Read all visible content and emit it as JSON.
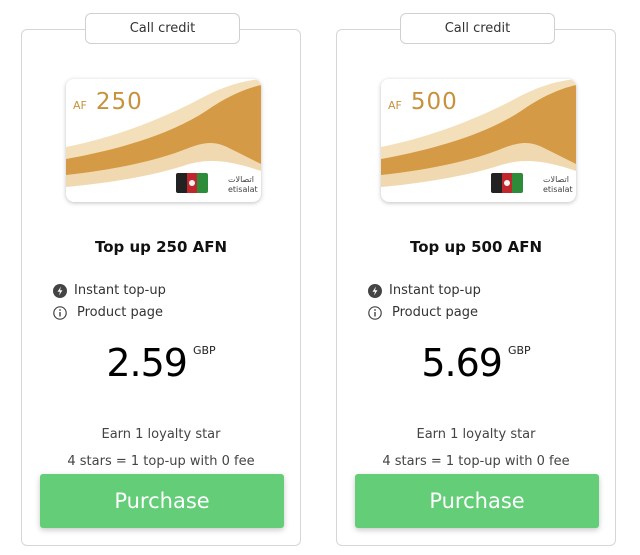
{
  "colors": {
    "accent_green": "#63cd78",
    "card_gold": "#d49a45",
    "card_light_gold": "#f0d9b0",
    "logo_green": "#8bbd2a"
  },
  "cards": [
    {
      "badge": "Call credit",
      "image": {
        "currency": "AF",
        "amount": "250",
        "logo_arabic": "اتصالات",
        "logo_latin": "etisalat",
        "flag_icon": "afghanistan-flag-icon",
        "logo_icon": "etisalat-logo-icon"
      },
      "title": "Top up 250 AFN",
      "features": [
        {
          "icon": "lightning-icon",
          "label": "Instant top-up"
        },
        {
          "icon": "info-icon",
          "label": "Product page"
        }
      ],
      "price": {
        "amount": "2.59",
        "currency": "GBP"
      },
      "loyalty_line1": "Earn 1 loyalty star",
      "loyalty_line2": "4 stars = 1 top-up with 0 fee",
      "button_label": "Purchase"
    },
    {
      "badge": "Call credit",
      "image": {
        "currency": "AF",
        "amount": "500",
        "logo_arabic": "اتصالات",
        "logo_latin": "etisalat",
        "flag_icon": "afghanistan-flag-icon",
        "logo_icon": "etisalat-logo-icon"
      },
      "title": "Top up 500 AFN",
      "features": [
        {
          "icon": "lightning-icon",
          "label": "Instant top-up"
        },
        {
          "icon": "info-icon",
          "label": "Product page"
        }
      ],
      "price": {
        "amount": "5.69",
        "currency": "GBP"
      },
      "loyalty_line1": "Earn 1 loyalty star",
      "loyalty_line2": "4 stars = 1 top-up with 0 fee",
      "button_label": "Purchase"
    }
  ]
}
